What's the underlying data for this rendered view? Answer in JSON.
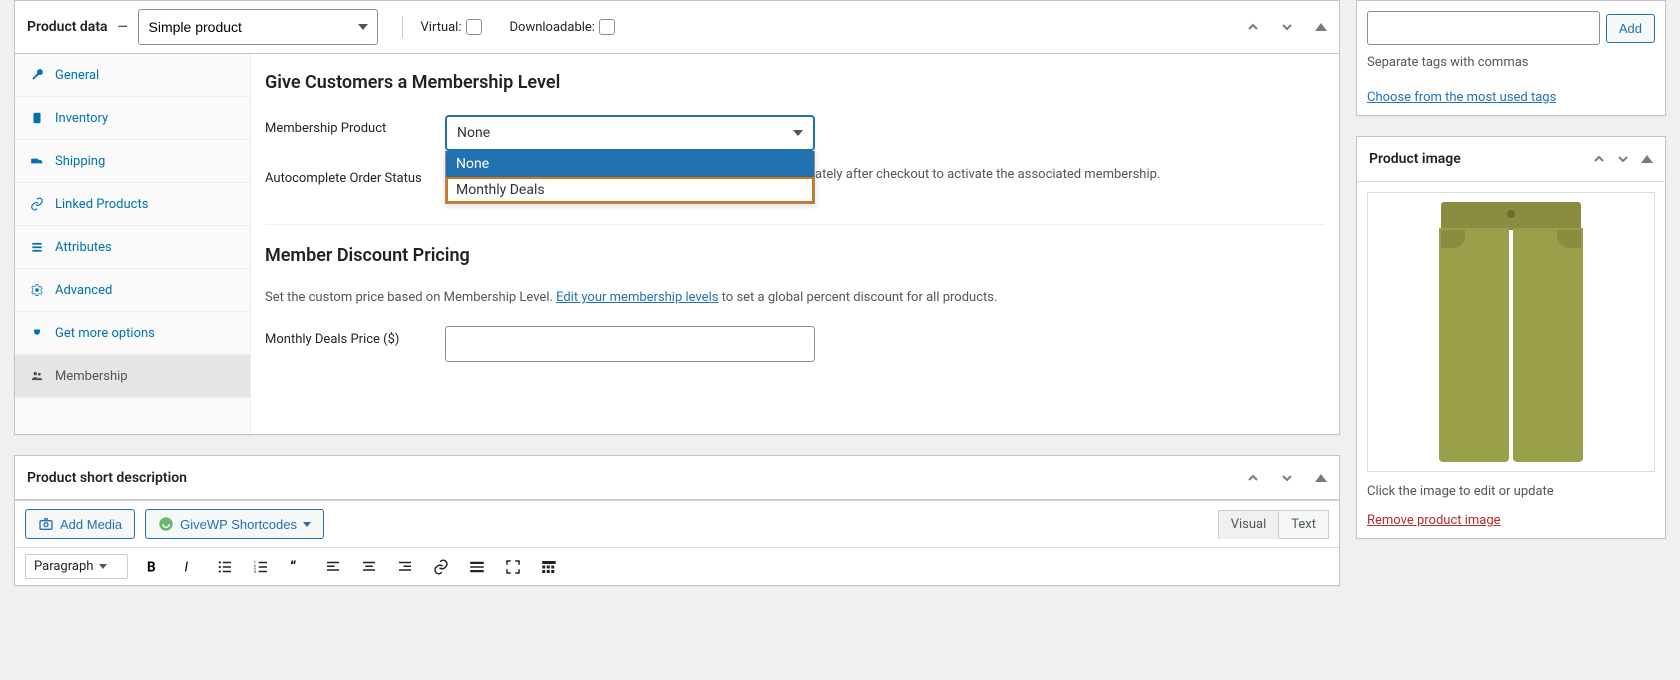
{
  "product_data": {
    "title": "Product data",
    "type_selected": "Simple product",
    "virtual_label": "Virtual:",
    "downloadable_label": "Downloadable:"
  },
  "tabs": [
    {
      "id": "general",
      "label": "General"
    },
    {
      "id": "inventory",
      "label": "Inventory"
    },
    {
      "id": "shipping",
      "label": "Shipping"
    },
    {
      "id": "linked",
      "label": "Linked Products"
    },
    {
      "id": "attributes",
      "label": "Attributes"
    },
    {
      "id": "advanced",
      "label": "Advanced"
    },
    {
      "id": "getmore",
      "label": "Get more options"
    },
    {
      "id": "membership",
      "label": "Membership"
    }
  ],
  "membership_section": {
    "heading": "Give Customers a Membership Level",
    "product_label": "Membership Product",
    "selected": "None",
    "options": [
      "None",
      "Monthly Deals"
    ],
    "autocomplete_label": "Autocomplete Order Status",
    "autocomplete_help_tail": "ately after checkout to activate the associated membership."
  },
  "discount_section": {
    "heading": "Member Discount Pricing",
    "desc_prefix": "Set the custom price based on Membership Level. ",
    "desc_link": "Edit your membership levels",
    "desc_suffix": " to set a global percent discount for all products.",
    "price_label": "Monthly Deals Price ($)"
  },
  "short_desc": {
    "title": "Product short description",
    "add_media": "Add Media",
    "givewp": "GiveWP Shortcodes",
    "visual": "Visual",
    "text": "Text",
    "paragraph": "Paragraph"
  },
  "tags_box": {
    "add": "Add",
    "hint": "Separate tags with commas",
    "choose": "Choose from the most used tags"
  },
  "image_box": {
    "title": "Product image",
    "hint": "Click the image to edit or update",
    "remove": "Remove product image"
  }
}
